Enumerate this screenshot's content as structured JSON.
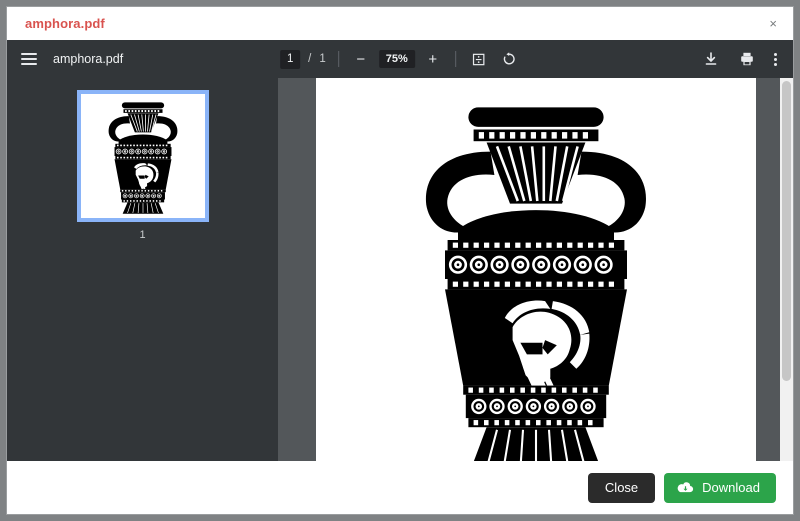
{
  "modal": {
    "title": "amphora.pdf",
    "close_icon": "close-x-icon",
    "close_label": "×"
  },
  "pdf_toolbar": {
    "menu_icon": "hamburger-menu-icon",
    "filename": "amphora.pdf",
    "page_current": "1",
    "page_separator": "/",
    "page_total": "1",
    "zoom_out_label": "−",
    "zoom_value": "75%",
    "zoom_in_label": "+",
    "fit_page_icon": "fit-to-page-icon",
    "rotate_icon": "rotate-counterclockwise-icon",
    "download_icon": "download-icon",
    "print_icon": "print-icon",
    "more_icon": "more-options-icon"
  },
  "sidebar": {
    "thumbnails": [
      {
        "page_label": "1",
        "selected": true
      }
    ]
  },
  "document": {
    "artwork_name": "greek-amphora-with-spartan-helmet",
    "page_background": "#ffffff",
    "ink_color": "#000000"
  },
  "footer": {
    "close_label": "Close",
    "download_label": "Download",
    "download_icon": "cloud-download-icon"
  },
  "colors": {
    "title_red": "#d9534f",
    "toolbar_dark": "#323639",
    "viewer_gray": "#53575a",
    "thumb_selection_blue": "#8ab4f8",
    "download_green": "#2ca44a",
    "close_dark": "#2b2b2b"
  }
}
